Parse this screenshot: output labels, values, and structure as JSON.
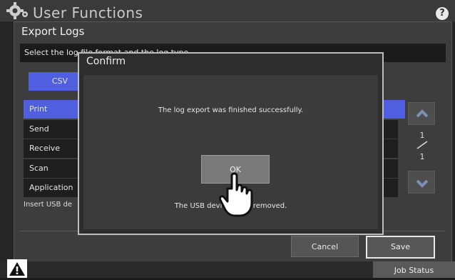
{
  "app": {
    "title": "User Functions",
    "help_label": "?"
  },
  "panel": {
    "title": "Export Logs",
    "instruction": "Select the log file format and the log type.",
    "format_tab": "CSV",
    "log_types": [
      "Print",
      "Send",
      "Receive",
      "Scan",
      "Application"
    ],
    "selected_log_type": "Print",
    "page_indicator": {
      "current": "1",
      "total": "1"
    },
    "insert_text": "Insert USB de",
    "buttons": {
      "cancel": "Cancel",
      "save": "Save"
    }
  },
  "footer": {
    "job_status": "Job Status"
  },
  "dialog": {
    "title": "Confirm",
    "message": "The log export was finished successfully.",
    "ok_label": "OK",
    "note": "The USB devic         e removed."
  },
  "colors": {
    "accent": "#4f5fe0",
    "panel_bg": "#3d3d3d",
    "dialog_border": "#bdbdbd"
  },
  "icons": {
    "settings": "gear-icon",
    "help": "help-icon",
    "warning": "warning-icon",
    "pointer": "hand-pointer-icon",
    "scroll_up": "chevron-up-icon",
    "scroll_down": "chevron-down-icon"
  }
}
